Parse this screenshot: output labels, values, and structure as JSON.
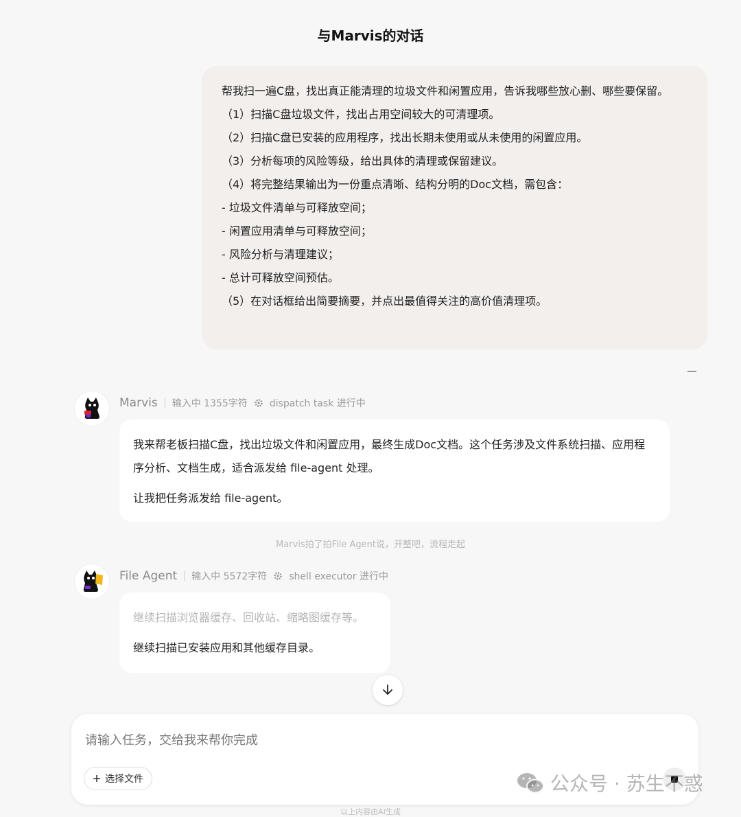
{
  "page": {
    "title": "与Marvis的对话"
  },
  "user_message": {
    "lines": [
      "帮我扫一遍C盘，找出真正能清理的垃圾文件和闲置应用，告诉我哪些放心删、哪些要保留。",
      "（1）扫描C盘垃圾文件，找出占用空间较大的可清理项。",
      "（2）扫描C盘已安装的应用程序，找出长期未使用或从未使用的闲置应用。",
      "（3）分析每项的风险等级，给出具体的清理或保留建议。",
      "（4）将完整结果输出为一份重点清晰、结构分明的Doc文档，需包含：",
      "- 垃圾文件清单与可释放空间；",
      "- 闲置应用清单与可释放空间；",
      "- 风险分析与清理建议；",
      "- 总计可释放空间预估。",
      "（5）在对话框给出简要摘要，并点出最值得关注的高价值清理项。"
    ]
  },
  "marvis": {
    "name": "Marvis",
    "input_status": "输入中 1355字符",
    "task_status": "dispatch task 进行中",
    "paragraphs": [
      "我来帮老板扫描C盘，找出垃圾文件和闲置应用，最终生成Doc文档。这个任务涉及文件系统扫描、应用程序分析、文档生成，适合派发给 file-agent 处理。",
      "让我把任务派发给 file-agent。"
    ]
  },
  "system_note": "Marvis拍了拍File Agent说，开整吧，流程走起",
  "file_agent": {
    "name": "File Agent",
    "input_status": "输入中 5572字符",
    "task_status": "shell executor 进行中",
    "paragraphs": [
      "继续扫描浏览器缓存、回收站、缩略图缓存等。",
      "继续扫描已安装应用和其他缓存目录。"
    ]
  },
  "composer": {
    "placeholder": "请输入任务，交给我来帮你完成",
    "file_button_label": "选择文件"
  },
  "watermark": {
    "text": "公众号 · 苏生不惑"
  },
  "footnote": "以上内容由AI生成",
  "icons": {
    "scroll_down": "arrow-down-icon",
    "gear": "gear-icon",
    "plus": "plus-icon",
    "stop": "stop-icon"
  }
}
